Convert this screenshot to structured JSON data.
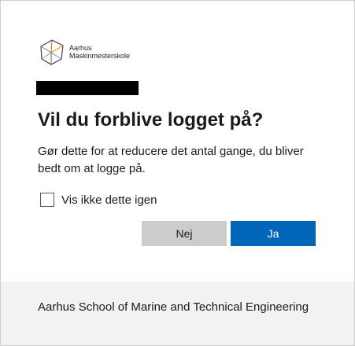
{
  "logo": {
    "line1": "Aarhus",
    "line2": "Maskinmesterskole"
  },
  "dialog": {
    "title": "Vil du forblive logget på?",
    "description": "Gør dette for at reducere det antal gange, du bliver bedt om at logge på.",
    "checkbox_label": "Vis ikke dette igen",
    "checkbox_checked": false,
    "no_label": "Nej",
    "yes_label": "Ja"
  },
  "footer": {
    "text": "Aarhus School of Marine and Technical Engineering"
  },
  "colors": {
    "primary": "#0067b8",
    "secondary_button": "#cccccc",
    "footer_bg": "#f2f2f2"
  }
}
